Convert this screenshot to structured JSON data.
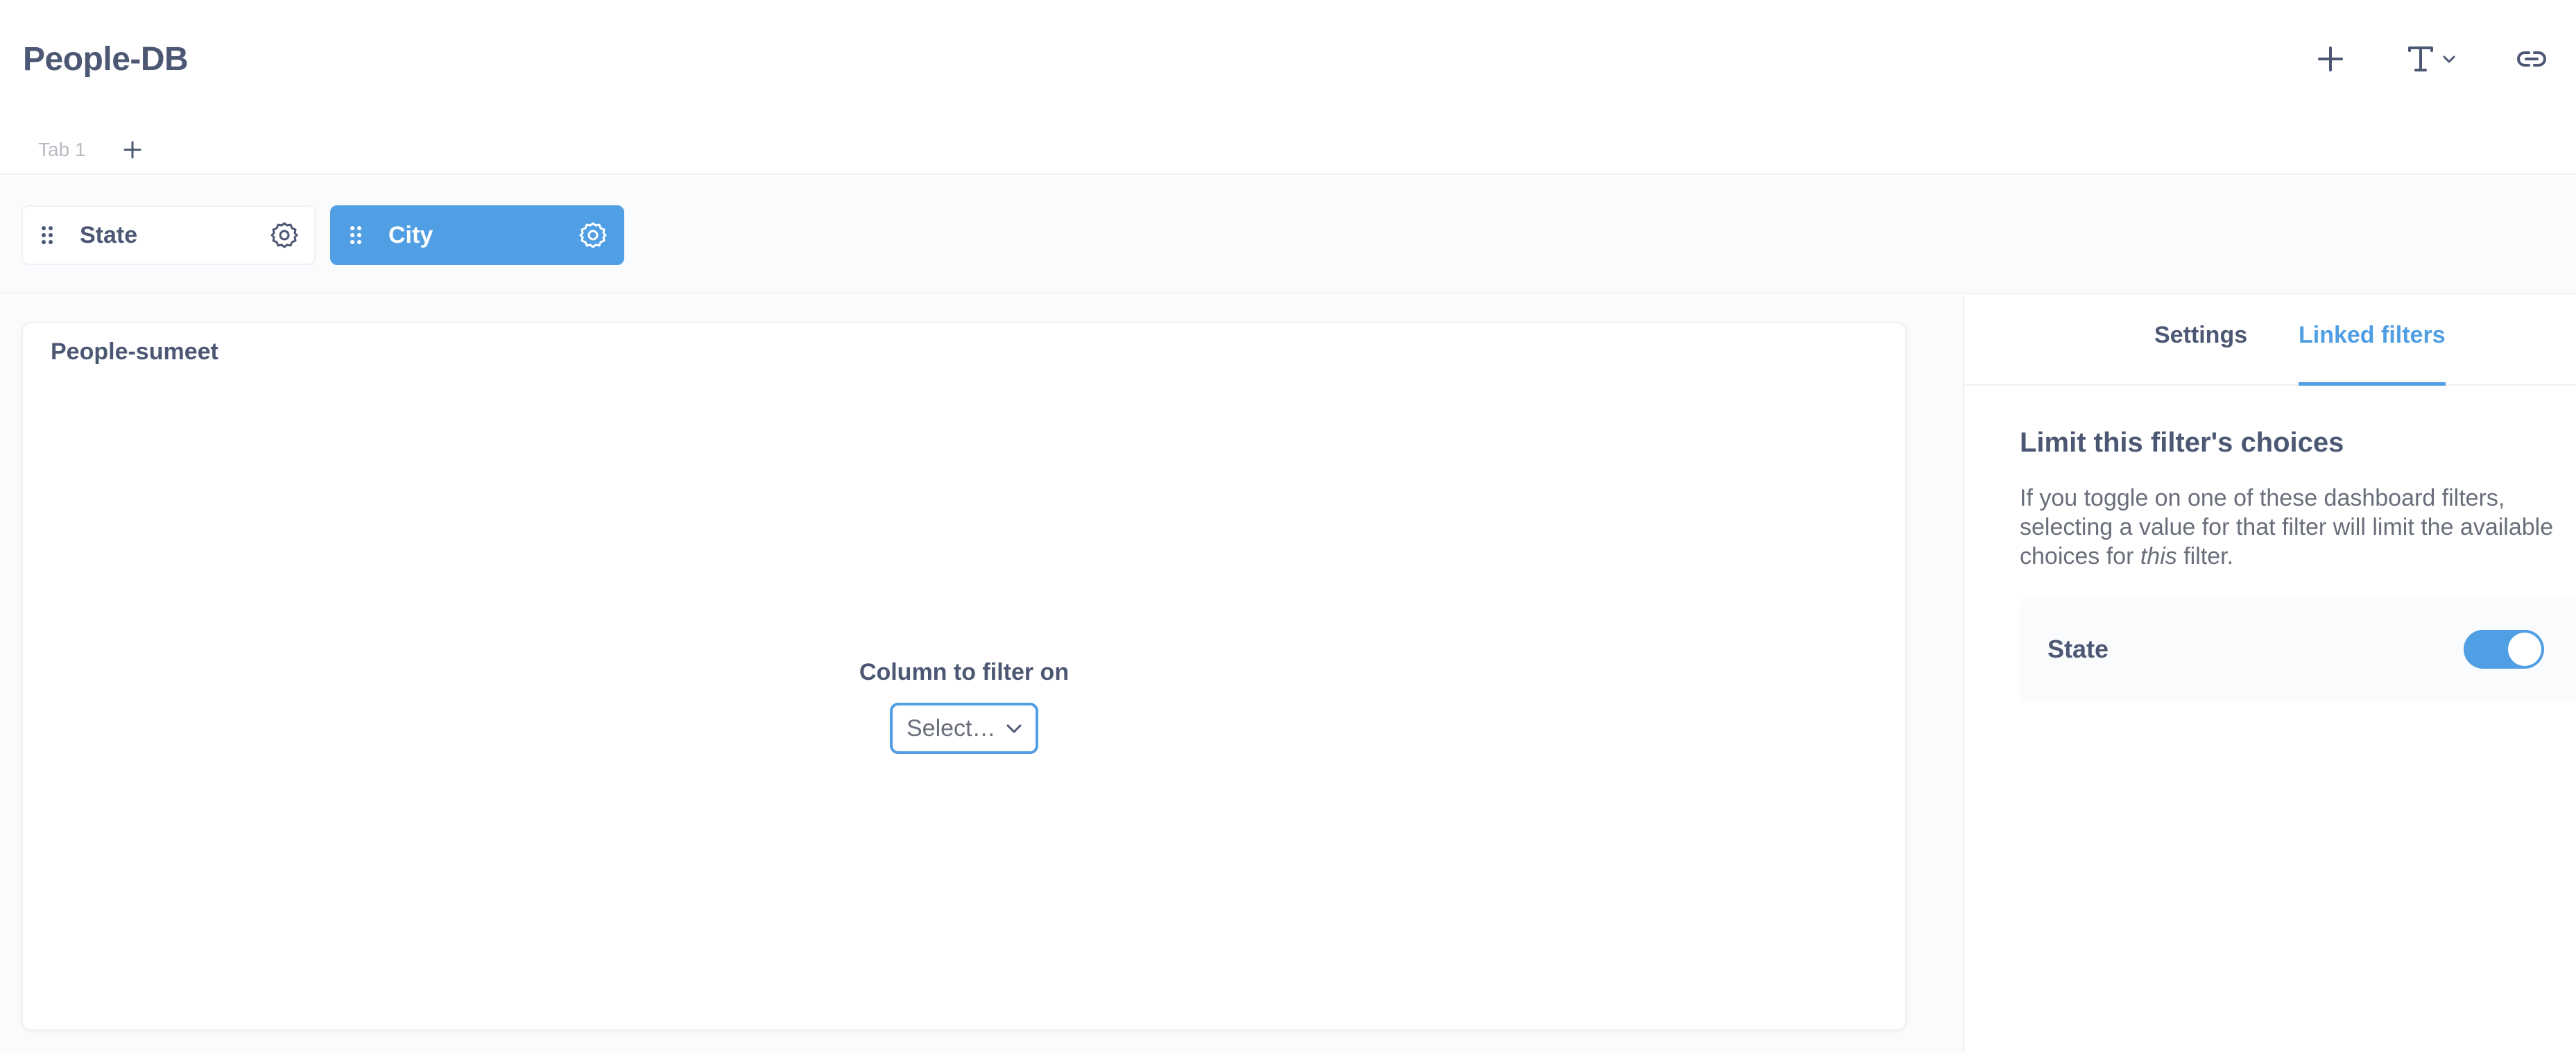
{
  "header": {
    "title": "People-DB",
    "toolbar": {
      "add_icon": "plus-icon",
      "text_icon": "text-format-icon",
      "link_icon": "link-icon",
      "filter_icon": "filter-icon"
    },
    "tabs": [
      {
        "label": "Tab 1"
      }
    ],
    "add_tab_icon": "plus-icon"
  },
  "filters": [
    {
      "label": "State",
      "active": false
    },
    {
      "label": "City",
      "active": true
    }
  ],
  "card": {
    "title": "People-sumeet",
    "column_filter_label": "Column to filter on",
    "select_placeholder": "Select…"
  },
  "sidebar": {
    "tabs": [
      {
        "label": "Settings",
        "active": false
      },
      {
        "label": "Linked filters",
        "active": true
      }
    ],
    "section_title": "Limit this filter's choices",
    "description_before": "If you toggle on one of these dashboard filters, selecting a value for that filter will limit the available choices for ",
    "description_emphasis": "this",
    "description_after": " filter.",
    "linked_filters": [
      {
        "label": "State",
        "enabled": true
      }
    ]
  },
  "colors": {
    "brand": "#509ee3",
    "text_dark": "#4c5773",
    "text_medium": "#696e7b",
    "text_light": "#b8bbc3",
    "border": "#eef0f3",
    "background_light": "#f9fbfc"
  }
}
